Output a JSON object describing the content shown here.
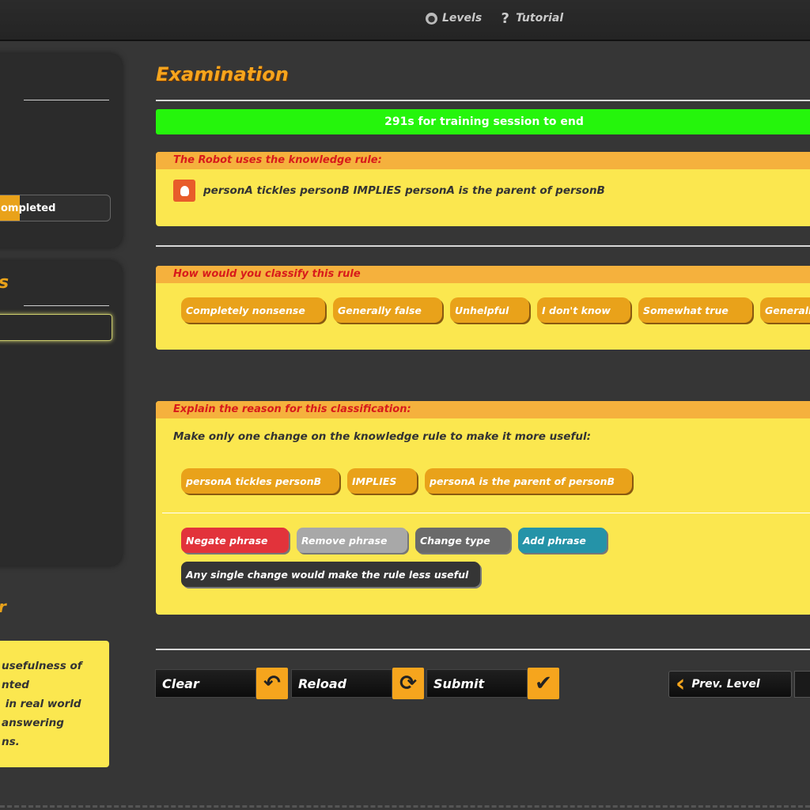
{
  "nav": {
    "levels": "Levels",
    "tutorial": "Tutorial"
  },
  "sidebar": {
    "progress_label": "ompleted",
    "progress_fraction": 0.28,
    "panel2_title": "s",
    "panel3_title": "r",
    "note": "usefulness of\nnted\n in real world\nanswering\nns."
  },
  "main": {
    "title": "Examination",
    "timer": "291s for training session to end",
    "rule_box": {
      "header": "The Robot uses the knowledge rule:",
      "rule": "personA tickles personB IMPLIES personA is the parent of personB"
    },
    "classify_box": {
      "header": "How would you classify this rule",
      "options": [
        "Completely nonsense",
        "Generally false",
        "Unhelpful",
        "I don't know",
        "Somewhat true",
        "Generally"
      ]
    },
    "explain_box": {
      "header": "Explain the reason for this classification:",
      "instruction": "Make only one change on the knowledge rule to make it more useful:",
      "phrases": [
        "personA tickles personB",
        "IMPLIES",
        "personA is the parent of personB"
      ],
      "actions": [
        {
          "label": "Negate phrase",
          "color": "#e2333b"
        },
        {
          "label": "Remove phrase",
          "color": "#a8a8a8"
        },
        {
          "label": "Change type",
          "color": "#6a6a6a"
        },
        {
          "label": "Add phrase",
          "color": "#2593a8"
        }
      ],
      "no_change": "Any single change would make the rule less useful"
    },
    "bottom": {
      "clear": "Clear",
      "reload": "Reload",
      "submit": "Submit",
      "prev_level": "Prev. Level"
    }
  }
}
